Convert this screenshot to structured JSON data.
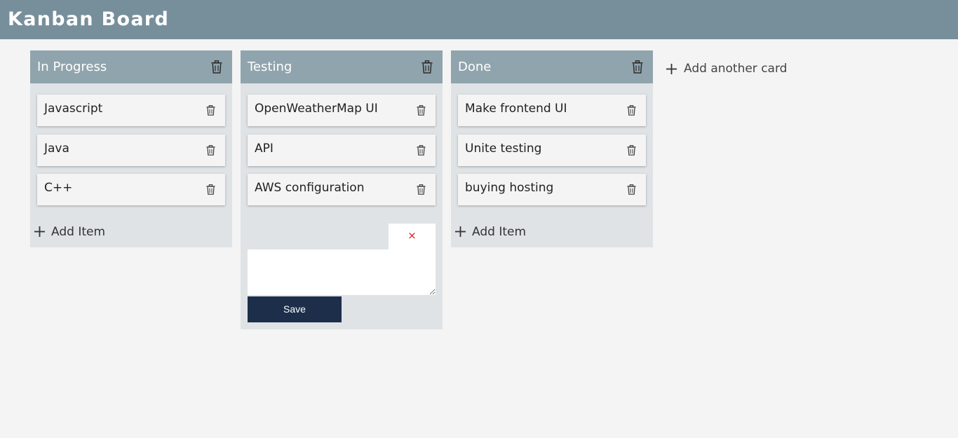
{
  "header": {
    "title": "Kanban Board"
  },
  "columns": [
    {
      "title": "In Progress",
      "cards": [
        {
          "text": "Javascript"
        },
        {
          "text": "Java"
        },
        {
          "text": "C++"
        }
      ],
      "add_item_label": "Add Item"
    },
    {
      "title": "Testing",
      "cards": [
        {
          "text": "OpenWeatherMap UI"
        },
        {
          "text": "API"
        },
        {
          "text": "AWS configuration"
        }
      ],
      "editor": {
        "close_symbol": "×",
        "textarea_value": "",
        "save_label": "Save"
      }
    },
    {
      "title": "Done",
      "cards": [
        {
          "text": "Make frontend UI"
        },
        {
          "text": "Unite testing"
        },
        {
          "text": "buying hosting"
        }
      ],
      "add_item_label": "Add Item"
    }
  ],
  "add_card_label": "Add another card",
  "icons": {
    "column_delete": "trash-icon",
    "card_delete": "trash-icon",
    "add": "plus-icon",
    "close": "close-icon"
  },
  "colors": {
    "header_bg": "#778f9b",
    "column_header_bg": "#90a4ad",
    "column_bg": "#dfe3e6",
    "save_button_bg": "#1c2e4a",
    "close_icon": "#d62020"
  }
}
